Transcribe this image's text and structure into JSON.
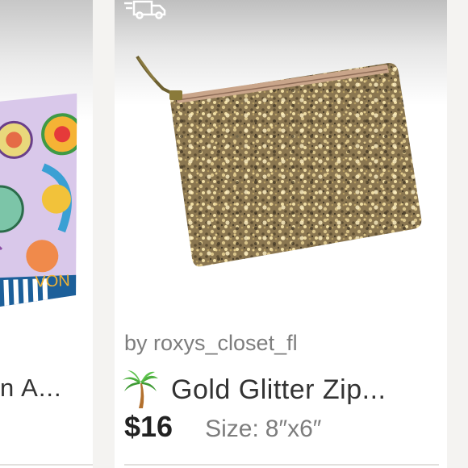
{
  "left_card": {
    "title_fragment": "n A...",
    "brand_fragment": "VON"
  },
  "right_card": {
    "seller": "by roxys_closet_fl",
    "title": "Gold Glitter Zip...",
    "price": "$16",
    "size_label": "Size:",
    "size_value": "8″x6″",
    "icons": {
      "shipping": "truck-icon",
      "emoji": "palm-tree-icon"
    }
  },
  "colors": {
    "background": "#f4f3f1",
    "card": "#ffffff",
    "text_dark": "#222222",
    "text_muted": "#7d7d7d",
    "glitter_gold": "#8a7650"
  }
}
